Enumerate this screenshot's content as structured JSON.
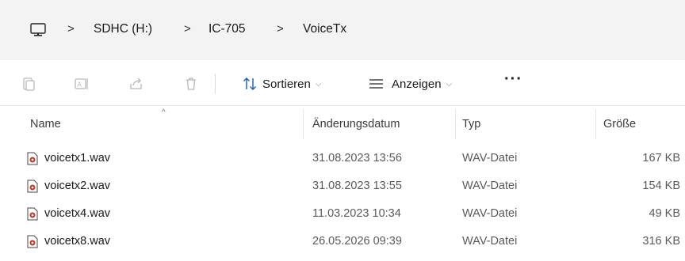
{
  "breadcrumb": {
    "items": [
      "SDHC (H:)",
      "IC-705",
      "VoiceTx"
    ],
    "separator": ">"
  },
  "toolbar": {
    "sort_label": "Sortieren",
    "view_label": "Anzeigen",
    "more_label": "···"
  },
  "columns": {
    "name": "Name",
    "date": "Änderungsdatum",
    "type": "Typ",
    "size": "Größe"
  },
  "files": [
    {
      "name": "voicetx1.wav",
      "date": "31.08.2023 13:56",
      "type": "WAV-Datei",
      "size": "167 KB"
    },
    {
      "name": "voicetx2.wav",
      "date": "31.08.2023 13:55",
      "type": "WAV-Datei",
      "size": "154 KB"
    },
    {
      "name": "voicetx4.wav",
      "date": "11.03.2023 10:34",
      "type": "WAV-Datei",
      "size": "49 KB"
    },
    {
      "name": "voicetx8.wav",
      "date": "26.05.2026 09:39",
      "type": "WAV-Datei",
      "size": "316 KB"
    }
  ],
  "icons": {
    "computer": "computer-icon",
    "file": "wav-file-icon",
    "cut": "cut-icon",
    "rename": "rename-icon",
    "share": "share-icon",
    "delete": "delete-icon",
    "sort": "sort-icon",
    "view": "view-icon"
  },
  "colors": {
    "address_bar_bg": "#f3f3f3",
    "file_icon_accent": "#c0392b"
  }
}
